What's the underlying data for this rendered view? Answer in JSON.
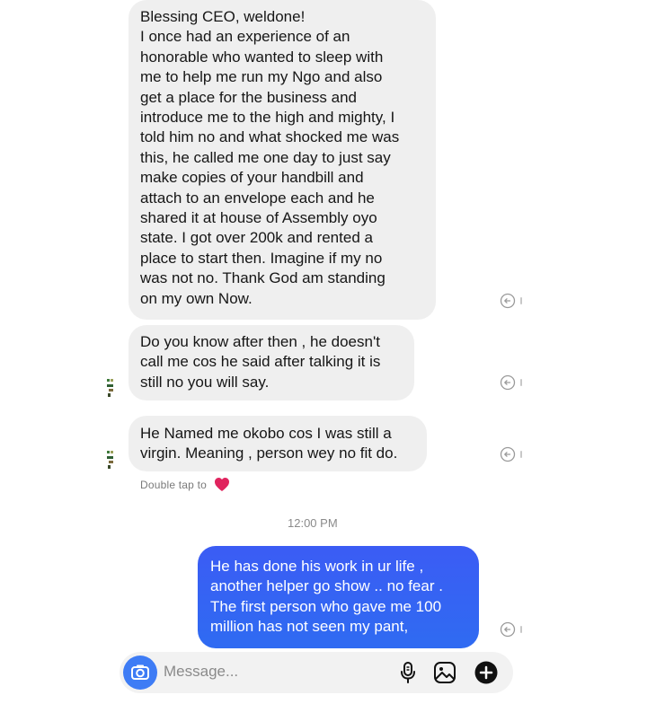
{
  "messages": [
    {
      "lines": [
        "Blessing CEO, weldone!",
        "I once had an experience of an",
        "honorable who wanted to sleep with",
        "me to help me run my Ngo and also",
        "get a place for the business and",
        "introduce me to the high and mighty,  I",
        "told him no and what shocked me was",
        "this, he called me one day to just say",
        "make copies of your handbill and",
        "attach to an envelope each and he",
        "shared it at house of Assembly oyo",
        "state. I got over 200k and rented a",
        "place to start then. Imagine if my no",
        "was not no. Thank God am standing",
        "on my own Now."
      ]
    },
    {
      "lines": [
        "Do you know after then , he doesn't",
        "call me cos he said after talking it is",
        "still no you will say."
      ]
    },
    {
      "lines": [
        "He Named me okobo cos I was still a",
        "virgin. Meaning , person wey no fit do."
      ]
    },
    {
      "lines": [
        "He has done his work in ur life ,",
        "another helper go show ..  no fear .",
        "The first person who gave me 100",
        "million has not seen my pant,"
      ]
    }
  ],
  "double_tap_hint": "Double tap to",
  "heart_emoji": "❤️",
  "timestamp": "12:00 PM",
  "composer": {
    "placeholder": "Message..."
  },
  "colors": {
    "incoming_bubble": "#efefef",
    "outgoing_bubble": "#3b5cf4",
    "camera_button": "#3e7cf5"
  },
  "icons": [
    "react-icon",
    "avatar-icon",
    "heart-icon",
    "camera-icon",
    "microphone-icon",
    "gallery-icon",
    "plus-icon"
  ]
}
